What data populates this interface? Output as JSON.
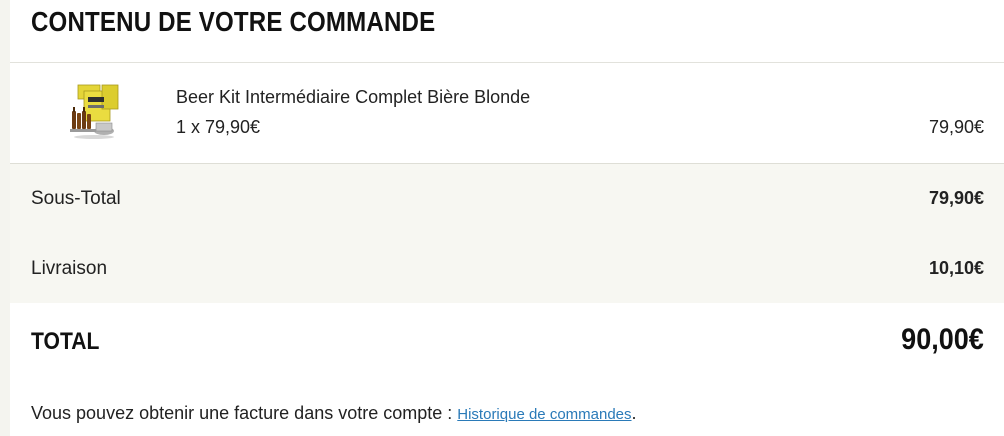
{
  "order": {
    "title": "CONTENU DE VOTRE COMMANDE",
    "items": [
      {
        "name": "Beer Kit Intermédiaire Complet Bière Blonde",
        "quantity_line": "1 x 79,90€",
        "line_total": "79,90€",
        "thumbnail_icon": "beer-kit-product-image"
      }
    ]
  },
  "summary": {
    "subtotal_label": "Sous-Total",
    "subtotal_value": "79,90€",
    "shipping_label": "Livraison",
    "shipping_value": "10,10€",
    "total_label": "TOTAL",
    "total_value": "90,00€"
  },
  "invoice": {
    "text": "Vous pouvez obtenir une facture dans votre compte : ",
    "link_label": "Historique de commandes",
    "suffix": "."
  },
  "colors": {
    "link": "#2a7ab8",
    "summary_background": "#f7f7f2",
    "product_yellow": "#e6d83a"
  }
}
